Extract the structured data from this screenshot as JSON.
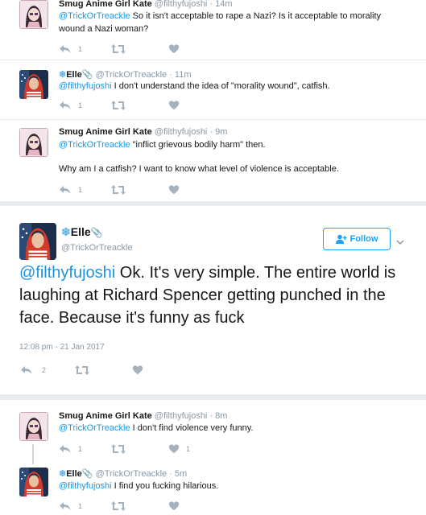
{
  "tweets": [
    {
      "name": "Smug Anime Girl Kate",
      "handle": "@filthyfujoshi",
      "time": "· 14m",
      "reply_to": "@TrickOrTreackle",
      "text": " So it isn't acceptable to rape a Nazi? Is it acceptable to morality wound a Nazi woman?",
      "reply_count": "1",
      "retweet_count": "",
      "like_count": ""
    },
    {
      "name": "Elle",
      "handle": "@TrickOrTreackle",
      "time": "· 11m",
      "reply_to": "@filthyfujoshi",
      "text": " I don't understand the idea of \"morality wound\", catfish.",
      "reply_count": "1",
      "retweet_count": "",
      "like_count": ""
    },
    {
      "name": "Smug Anime Girl Kate",
      "handle": "@filthyfujoshi",
      "time": "· 9m",
      "reply_to": "@TrickOrTreackle",
      "text": " \"inflict grievous bodily harm\" then.",
      "text2": "Why am I a catfish? I want to know what level of violence is acceptable.",
      "reply_count": "1",
      "retweet_count": "",
      "like_count": ""
    }
  ],
  "focused": {
    "name": "Elle",
    "handle": "@TrickOrTreackle",
    "follow_label": "Follow",
    "reply_to": "@filthyfujoshi",
    "text": " Ok. It's very simple. The entire world is laughing at Richard Spencer getting punched in the face. Because it's funny as fuck",
    "timestamp": "12:08 pm - 21 Jan 2017",
    "reply_count": "2",
    "retweet_count": "",
    "like_count": ""
  },
  "replies": [
    {
      "name": "Smug Anime Girl Kate",
      "handle": "@filthyfujoshi",
      "time": "· 8m",
      "reply_to": "@TrickOrTreackle",
      "text": " I don't find violence very funny.",
      "reply_count": "1",
      "retweet_count": "",
      "like_count": "1"
    },
    {
      "name": "Elle",
      "handle": "@TrickOrTreackle",
      "time": "· 5m",
      "reply_to": "@filthyfujoshi",
      "text": " I find you fucking hilarious.",
      "reply_count": "1",
      "retweet_count": "",
      "like_count": ""
    }
  ],
  "icons": {
    "snowflake": "❄",
    "paperclip": "📎"
  },
  "colors": {
    "link": "#1b95e0",
    "muted": "#8899a6",
    "follow": "#1da1f2"
  }
}
